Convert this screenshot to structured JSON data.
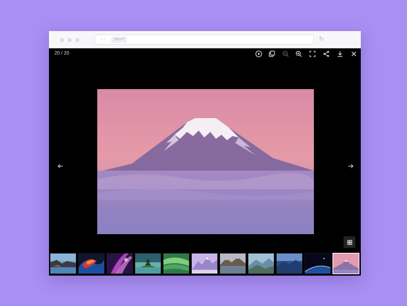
{
  "browser": {
    "address_pill": "https://",
    "nav_glyphs": "‹ ›",
    "reload_glyph": "↻"
  },
  "viewer": {
    "counter": "20 / 20",
    "toolbar": [
      {
        "name": "play-icon",
        "dim": false
      },
      {
        "name": "copy-icon",
        "dim": false
      },
      {
        "name": "zoom-out-icon",
        "dim": true
      },
      {
        "name": "zoom-in-icon",
        "dim": false
      },
      {
        "name": "fullscreen-icon",
        "dim": false
      },
      {
        "name": "share-icon",
        "dim": false
      },
      {
        "name": "download-icon",
        "dim": false
      },
      {
        "name": "close-icon",
        "dim": false
      }
    ],
    "prev_icon": "arrow-left-icon",
    "next_icon": "arrow-right-icon",
    "main_image": "mountain-fuji-pink-sky",
    "thumbnails": [
      {
        "subject": "coastal-rocks",
        "active": false
      },
      {
        "subject": "red-blue-abstract",
        "active": false
      },
      {
        "subject": "purple-aurora",
        "active": false
      },
      {
        "subject": "tree-island",
        "active": false
      },
      {
        "subject": "green-wave",
        "active": false
      },
      {
        "subject": "lavender-peaks",
        "active": false
      },
      {
        "subject": "mountain-lake",
        "active": false
      },
      {
        "subject": "mountain-haze",
        "active": false
      },
      {
        "subject": "blue-mountains",
        "active": false
      },
      {
        "subject": "earth-horizon",
        "active": false
      },
      {
        "subject": "pink-mountain",
        "active": true
      }
    ]
  },
  "colors": {
    "background": "#a98ff3",
    "viewer": "#000000",
    "chrome": "#f7f7f9"
  }
}
